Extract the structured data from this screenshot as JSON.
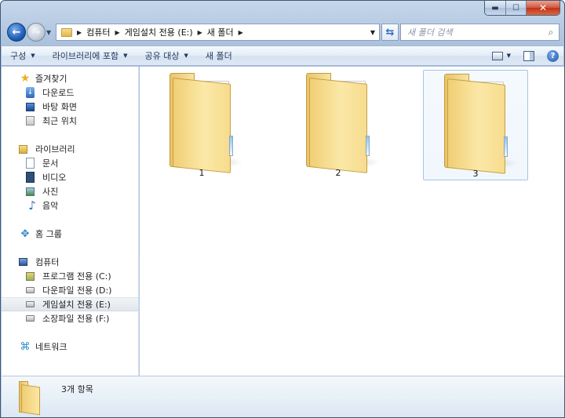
{
  "window": {
    "minimize_glyph": "▬",
    "maximize_glyph": "☐",
    "close_glyph": "✕"
  },
  "address": {
    "breadcrumbs": [
      "컴퓨터",
      "게임설치 전용 (E:)",
      "새 폴더"
    ],
    "separator_glyph": "▶",
    "dropdown_glyph": "▼",
    "refresh_glyph": "⇆"
  },
  "search": {
    "placeholder": "새 폴더 검색",
    "icon_glyph": "⌕"
  },
  "nav_buttons": {
    "back_glyph": "←",
    "forward_glyph": "→",
    "dropdown_glyph": "▼"
  },
  "toolbar": {
    "organize_label": "구성",
    "include_library_label": "라이브러리에 포함",
    "share_label": "공유 대상",
    "new_folder_label": "새 폴더",
    "dropdown_glyph": "▼",
    "help_glyph": "?"
  },
  "sidebar": {
    "favorites": {
      "label": "즐겨찾기",
      "items": [
        "다운로드",
        "바탕 화면",
        "최근 위치"
      ]
    },
    "libraries": {
      "label": "라이브러리",
      "items": [
        "문서",
        "비디오",
        "사진",
        "음악"
      ]
    },
    "homegroup": {
      "label": "홈 그룹"
    },
    "computer": {
      "label": "컴퓨터",
      "items": [
        "프로그램 전용 (C:)",
        "다운파일 전용 (D:)",
        "게임설치 전용 (E:)",
        "소장파일 전용 (F:)"
      ],
      "selected_index": 2
    },
    "network": {
      "label": "네트워크"
    },
    "icons": {
      "favorites": "star-icon",
      "downloads": "download-icon",
      "desktop": "desktop-icon",
      "recent": "recent-places-icon",
      "libraries": "library-icon",
      "documents": "document-icon",
      "videos": "video-icon",
      "pictures": "picture-icon",
      "music": "music-note-icon",
      "homegroup": "homegroup-icon",
      "computer": "computer-icon",
      "drive": "drive-icon",
      "network": "network-icon"
    },
    "glyphs": {
      "star": "★",
      "download": "↓",
      "music": "♪",
      "homegroup": "✥",
      "network": "⌘"
    }
  },
  "content": {
    "folders": [
      {
        "name": "1",
        "selected": false
      },
      {
        "name": "2",
        "selected": false
      },
      {
        "name": "3",
        "selected": true
      }
    ]
  },
  "details": {
    "item_count": "3개 항목"
  },
  "colors": {
    "frame": "#a9c0dc",
    "selection_border": "#a5c4e6",
    "folder": "#f0cf75",
    "close_button": "#d4543b"
  }
}
